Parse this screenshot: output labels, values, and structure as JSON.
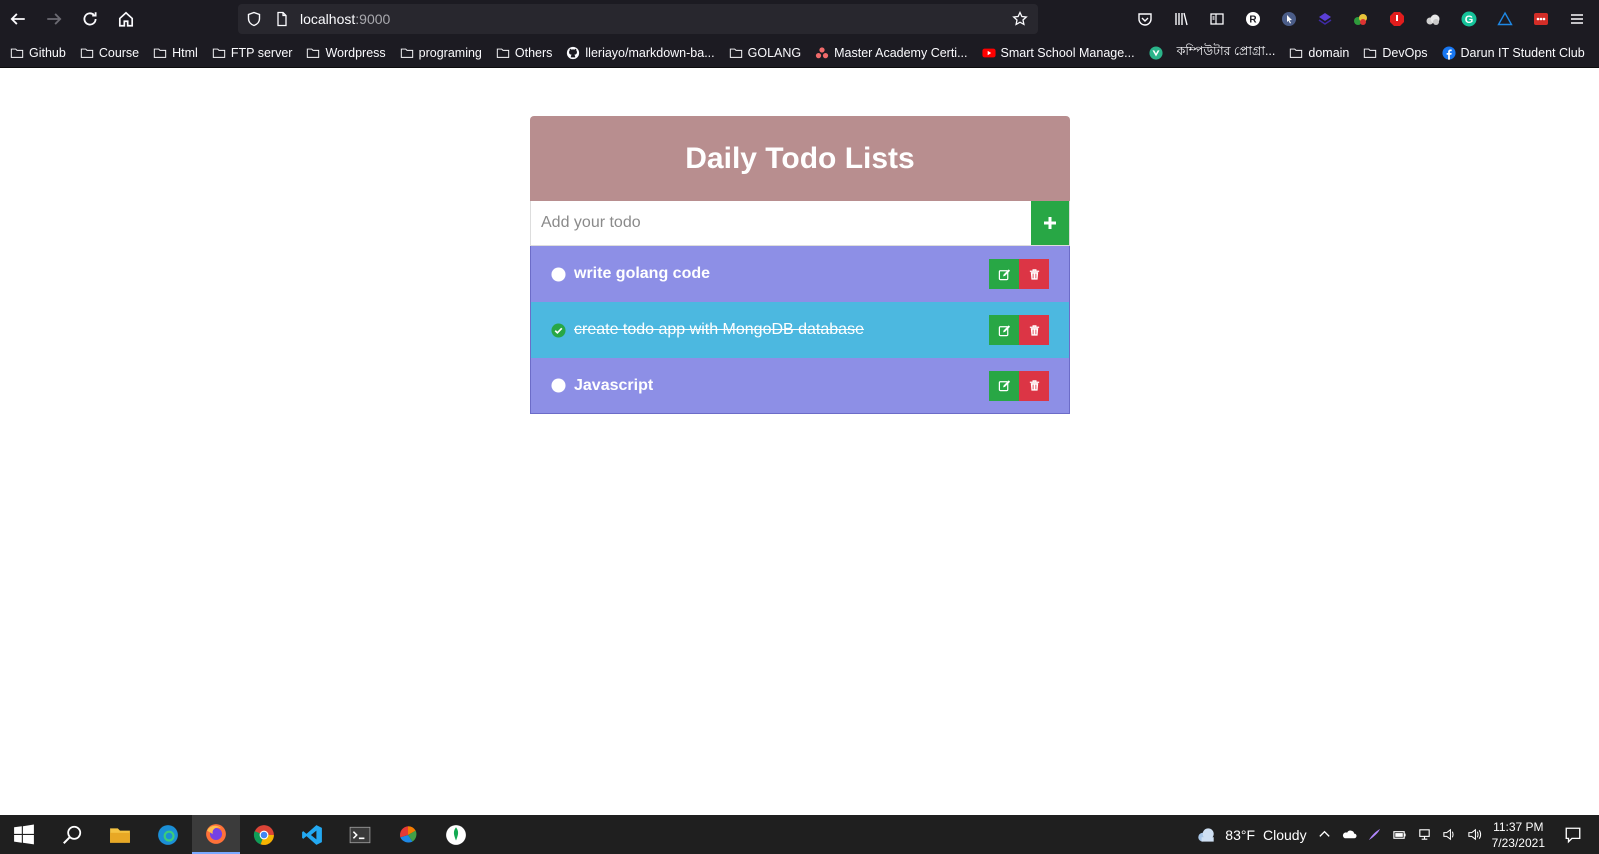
{
  "browser": {
    "url_host": "localhost",
    "url_port": ":9000",
    "bookmarks": [
      {
        "label": "Github",
        "icon": "folder-icon"
      },
      {
        "label": "Course",
        "icon": "folder-icon"
      },
      {
        "label": "Html",
        "icon": "folder-icon"
      },
      {
        "label": "FTP server",
        "icon": "folder-icon"
      },
      {
        "label": "Wordpress",
        "icon": "folder-icon"
      },
      {
        "label": "programing",
        "icon": "folder-icon"
      },
      {
        "label": "Others",
        "icon": "folder-icon"
      },
      {
        "label": "lleriayo/markdown-ba...",
        "icon": "github-icon"
      },
      {
        "label": "GOLANG",
        "icon": "folder-icon"
      },
      {
        "label": "Master Academy Certi...",
        "icon": "asana-icon"
      },
      {
        "label": "Smart School Manage...",
        "icon": "youtube-icon"
      },
      {
        "label": "",
        "icon": "vuejs-icon"
      },
      {
        "label": "কম্পিউটার প্রোগ্রা...",
        "icon": "none"
      },
      {
        "label": "domain",
        "icon": "folder-icon"
      },
      {
        "label": "DevOps",
        "icon": "folder-icon"
      },
      {
        "label": "Darun IT Student Club",
        "icon": "facebook-icon"
      }
    ]
  },
  "app": {
    "title": "Daily Todo Lists",
    "input_placeholder": "Add your todo",
    "todos": [
      {
        "text": "write golang code",
        "done": false
      },
      {
        "text": "create todo app with MongoDB database",
        "done": true
      },
      {
        "text": "Javascript",
        "done": false
      }
    ]
  },
  "taskbar": {
    "weather_temp": "83°F",
    "weather_text": "Cloudy",
    "time": "11:37 PM",
    "date": "7/23/2021"
  },
  "colors": {
    "header": "#b88e8f",
    "pending": "#8d8fe6",
    "done": "#4cb8e0",
    "add_button": "#28a745",
    "edit_button": "#28a745",
    "delete_button": "#dc3545"
  }
}
